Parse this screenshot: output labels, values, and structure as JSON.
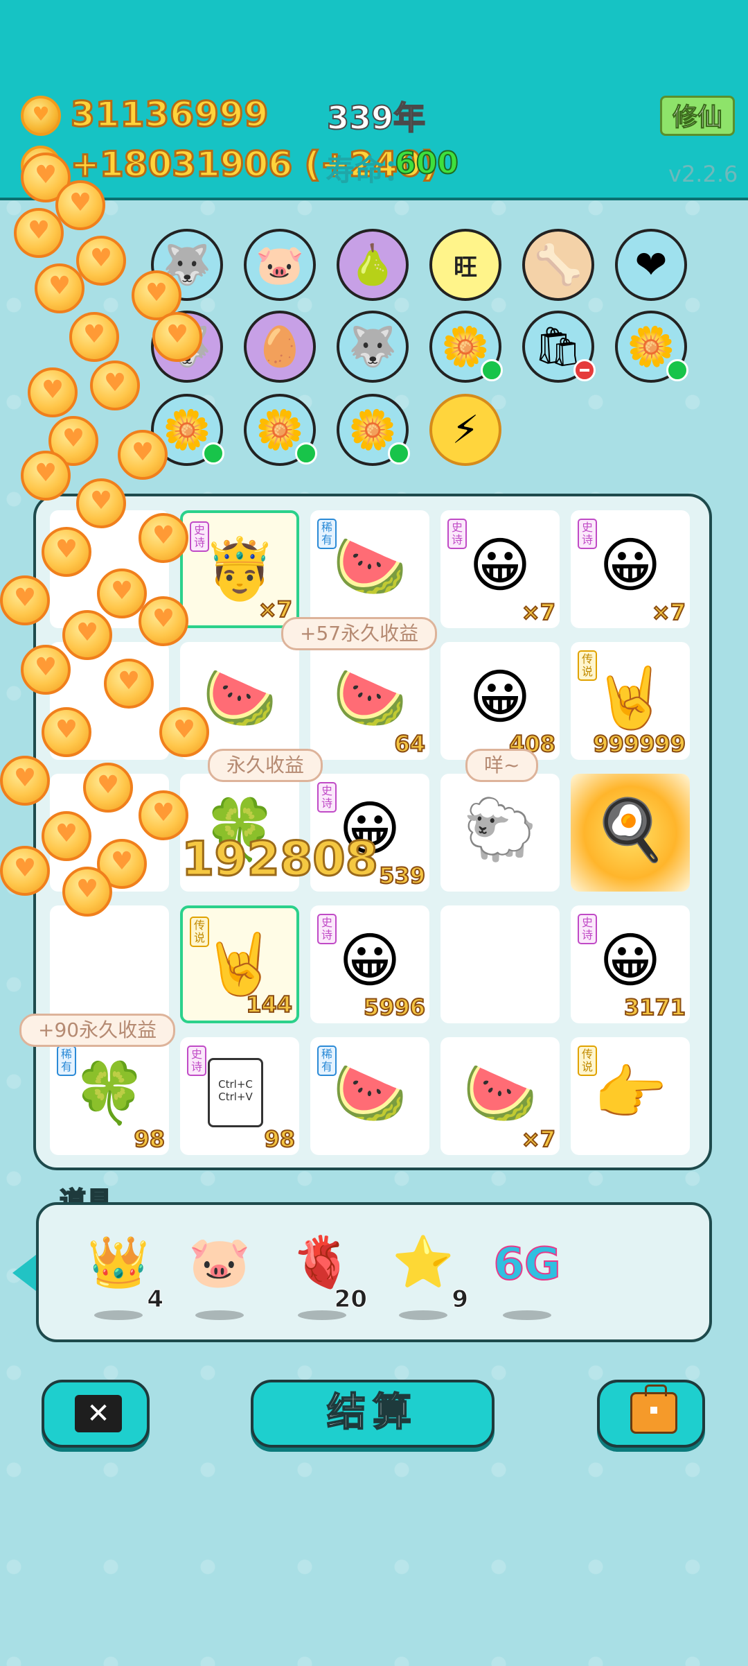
{
  "header": {
    "money": "31136999",
    "income": "+18031906 (+240)",
    "year": "339年",
    "life_label": "寿命：",
    "life_value": "600",
    "cultivate_button": "修仙",
    "version": "v2.2.6"
  },
  "item_circles": [
    [
      "husky-icon",
      "piggy-bank-icon",
      "pomelo-icon",
      "wang-wang-icon",
      "dog-food-icon",
      "heart-medicine-icon"
    ],
    [
      "husky-icon",
      "egg-icon",
      "husky-icon",
      "lily-plant-icon",
      "trash-bag-icon",
      "lily-plant-icon"
    ],
    [
      "lily-plant-icon",
      "lily-plant-icon",
      "lily-plant-icon",
      "lightning-icon"
    ]
  ],
  "board": {
    "cells": [
      {
        "tag": "史诗",
        "icon": "hero-face-crown",
        "num": "×7"
      },
      {
        "tag": "稀有",
        "icon": "watermelon",
        "num": ""
      },
      {
        "tag": "史诗",
        "icon": "hero-face",
        "num": "×7"
      },
      {
        "tag": "史诗",
        "icon": "hero-face-6g",
        "num": "×7"
      },
      {
        "tag": "",
        "icon": "watermelon",
        "num": ""
      },
      {
        "tag": "",
        "icon": "watermelon",
        "num": "64"
      },
      {
        "tag": "",
        "icon": "hero-face",
        "num": "408"
      },
      {
        "tag": "传说",
        "icon": "rock-hand",
        "num": "999999"
      },
      {
        "tag": "史诗",
        "icon": "hero-face",
        "num": "539"
      },
      {
        "tag": "",
        "icon": "sheep",
        "num": ""
      },
      {
        "tag": "",
        "icon": "pot-explosion",
        "num": ""
      },
      {
        "tag": "传说",
        "icon": "rock-hand-crown",
        "num": "144"
      },
      {
        "tag": "史诗",
        "icon": "hero-face",
        "num": "5996"
      },
      {
        "tag": "史诗",
        "icon": "hero-face-6g",
        "num": "3171"
      },
      {
        "tag": "稀有",
        "icon": "clover",
        "num": "98"
      },
      {
        "tag": "史诗",
        "icon": "ctrl-cv-cards",
        "num": "98"
      },
      {
        "tag": "稀有",
        "icon": "watermelon",
        "num": ""
      },
      {
        "tag": "",
        "icon": "watermelon",
        "num": "×7"
      },
      {
        "tag": "传说",
        "icon": "pointing-hand",
        "num": ""
      }
    ],
    "bubbles": {
      "top": "+57永久收益",
      "mid_left": "永久收益",
      "mid_right": "咩~",
      "bottom_left": "+90永久收益"
    },
    "damage_number": "192808",
    "ctrl_c": "Ctrl+C",
    "ctrl_v": "Ctrl+V",
    "six_g": "6G"
  },
  "props": {
    "title": "道具",
    "items": [
      {
        "icon": "crown-icon",
        "count": "4"
      },
      {
        "icon": "piggy-bank-icon",
        "count": ""
      },
      {
        "icon": "liver-icon",
        "count": "20"
      },
      {
        "icon": "star-icon",
        "count": "9"
      },
      {
        "icon": "6g-icon",
        "label": "6G",
        "count": ""
      }
    ]
  },
  "buttons": {
    "close": "close-button",
    "settle": "结算",
    "bag": "bag-button"
  },
  "colors": {
    "header_bg": "#16c3c4",
    "page_bg": "#a9dfe5",
    "coin": "#ffc64a",
    "accent_green": "#3ee03e"
  }
}
